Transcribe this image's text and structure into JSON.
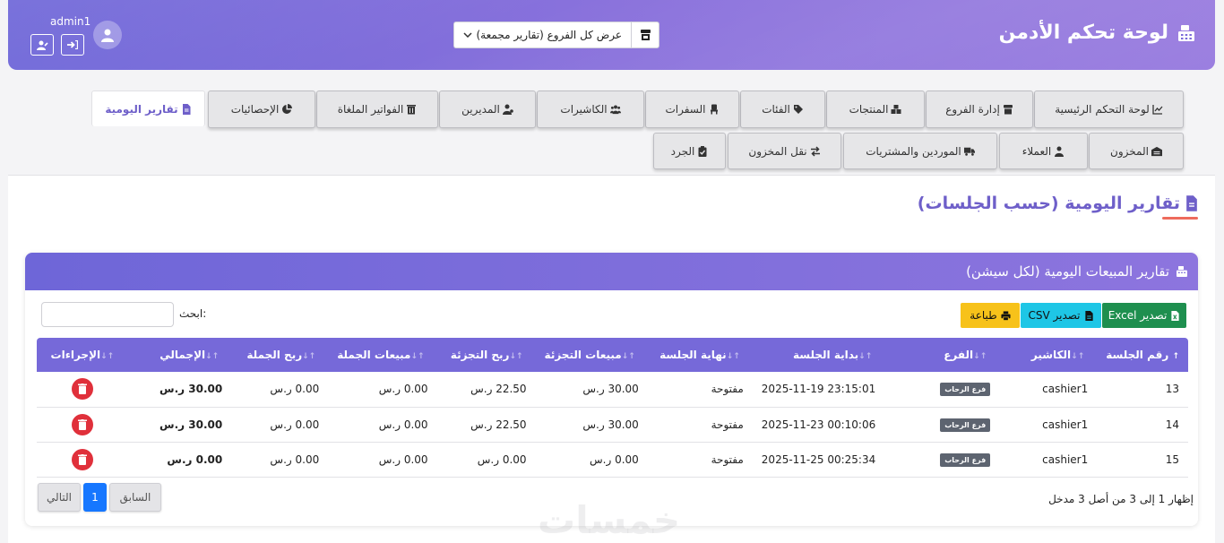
{
  "header": {
    "title": "لوحة تحكم الأدمن",
    "branch_select": "عرض كل الفروع (تقارير مجمعة)",
    "username": "admin1"
  },
  "tabs_row1": [
    {
      "label": "لوحة التحكم الرئيسية",
      "icon": "chart-line-icon"
    },
    {
      "label": "إدارة الفروع",
      "icon": "store-icon"
    },
    {
      "label": "المنتجات",
      "icon": "boxes-icon"
    },
    {
      "label": "الفئات",
      "icon": "tags-icon"
    },
    {
      "label": "السفرات",
      "icon": "chair-icon"
    },
    {
      "label": "الكاشيرات",
      "icon": "users-icon"
    },
    {
      "label": "المديرين",
      "icon": "user-tie-icon"
    },
    {
      "label": "الفواتير الملغاة",
      "icon": "trash-icon"
    },
    {
      "label": "الإحصائيات",
      "icon": "pie-chart-icon"
    },
    {
      "label": "تقارير اليومية",
      "icon": "file-icon"
    }
  ],
  "tabs_row2": [
    {
      "label": "المخزون",
      "icon": "warehouse-icon"
    },
    {
      "label": "العملاء",
      "icon": "user-icon"
    },
    {
      "label": "الموردين والمشتريات",
      "icon": "truck-icon"
    },
    {
      "label": "نقل المخزون",
      "icon": "exchange-icon"
    },
    {
      "label": "الجرد",
      "icon": "clipboard-check-icon"
    }
  ],
  "page": {
    "title": "تقارير اليومية (حسب الجلسات)"
  },
  "card": {
    "title": "تقارير المبيعات اليومية (لكل سيشن)",
    "buttons": {
      "excel": "تصدير Excel",
      "csv": "تصدير CSV",
      "print": "طباعة"
    },
    "search_label": "ابحث:",
    "columns": [
      "رقم الجلسة",
      "الكاشير",
      "الفرع",
      "بداية الجلسة",
      "نهاية الجلسة",
      "مبيعات التجزئة",
      "ربح التجزئة",
      "مبيعات الجملة",
      "ربح الجملة",
      "الإجمالي",
      "الإجراءات"
    ],
    "rows": [
      {
        "id": "13",
        "cashier": "cashier1",
        "branch": "فرع الرحاب",
        "start": "2025-11-19 23:15:01",
        "end": "مفتوحة",
        "retail_sales": "30.00 ر.س",
        "retail_profit": "22.50 ر.س",
        "wholesale_sales": "0.00 ر.س",
        "wholesale_profit": "0.00 ر.س",
        "total": "30.00 ر.س"
      },
      {
        "id": "14",
        "cashier": "cashier1",
        "branch": "فرع الرحاب",
        "start": "2025-11-23 00:10:06",
        "end": "مفتوحة",
        "retail_sales": "30.00 ر.س",
        "retail_profit": "22.50 ر.س",
        "wholesale_sales": "0.00 ر.س",
        "wholesale_profit": "0.00 ر.س",
        "total": "30.00 ر.س"
      },
      {
        "id": "15",
        "cashier": "cashier1",
        "branch": "فرع الرحاب",
        "start": "2025-11-25 00:25:34",
        "end": "مفتوحة",
        "retail_sales": "0.00 ر.س",
        "retail_profit": "0.00 ر.س",
        "wholesale_sales": "0.00 ر.س",
        "wholesale_profit": "0.00 ر.س",
        "total": "0.00 ر.س"
      }
    ],
    "info": "إظهار 1 إلى 3 من أصل 3 مدخل",
    "pager": {
      "prev": "السابق",
      "page": "1",
      "next": "التالي"
    }
  },
  "watermark": "خمسات",
  "colors": {
    "accent": "#6e5fc9",
    "header_start": "#6e66d8",
    "header_end": "#9b7fe0",
    "excel": "#1e8f4f",
    "csv": "#1ec6e6",
    "print": "#f7c21a",
    "delete": "#e0303b",
    "pager_active": "#1677ff"
  }
}
